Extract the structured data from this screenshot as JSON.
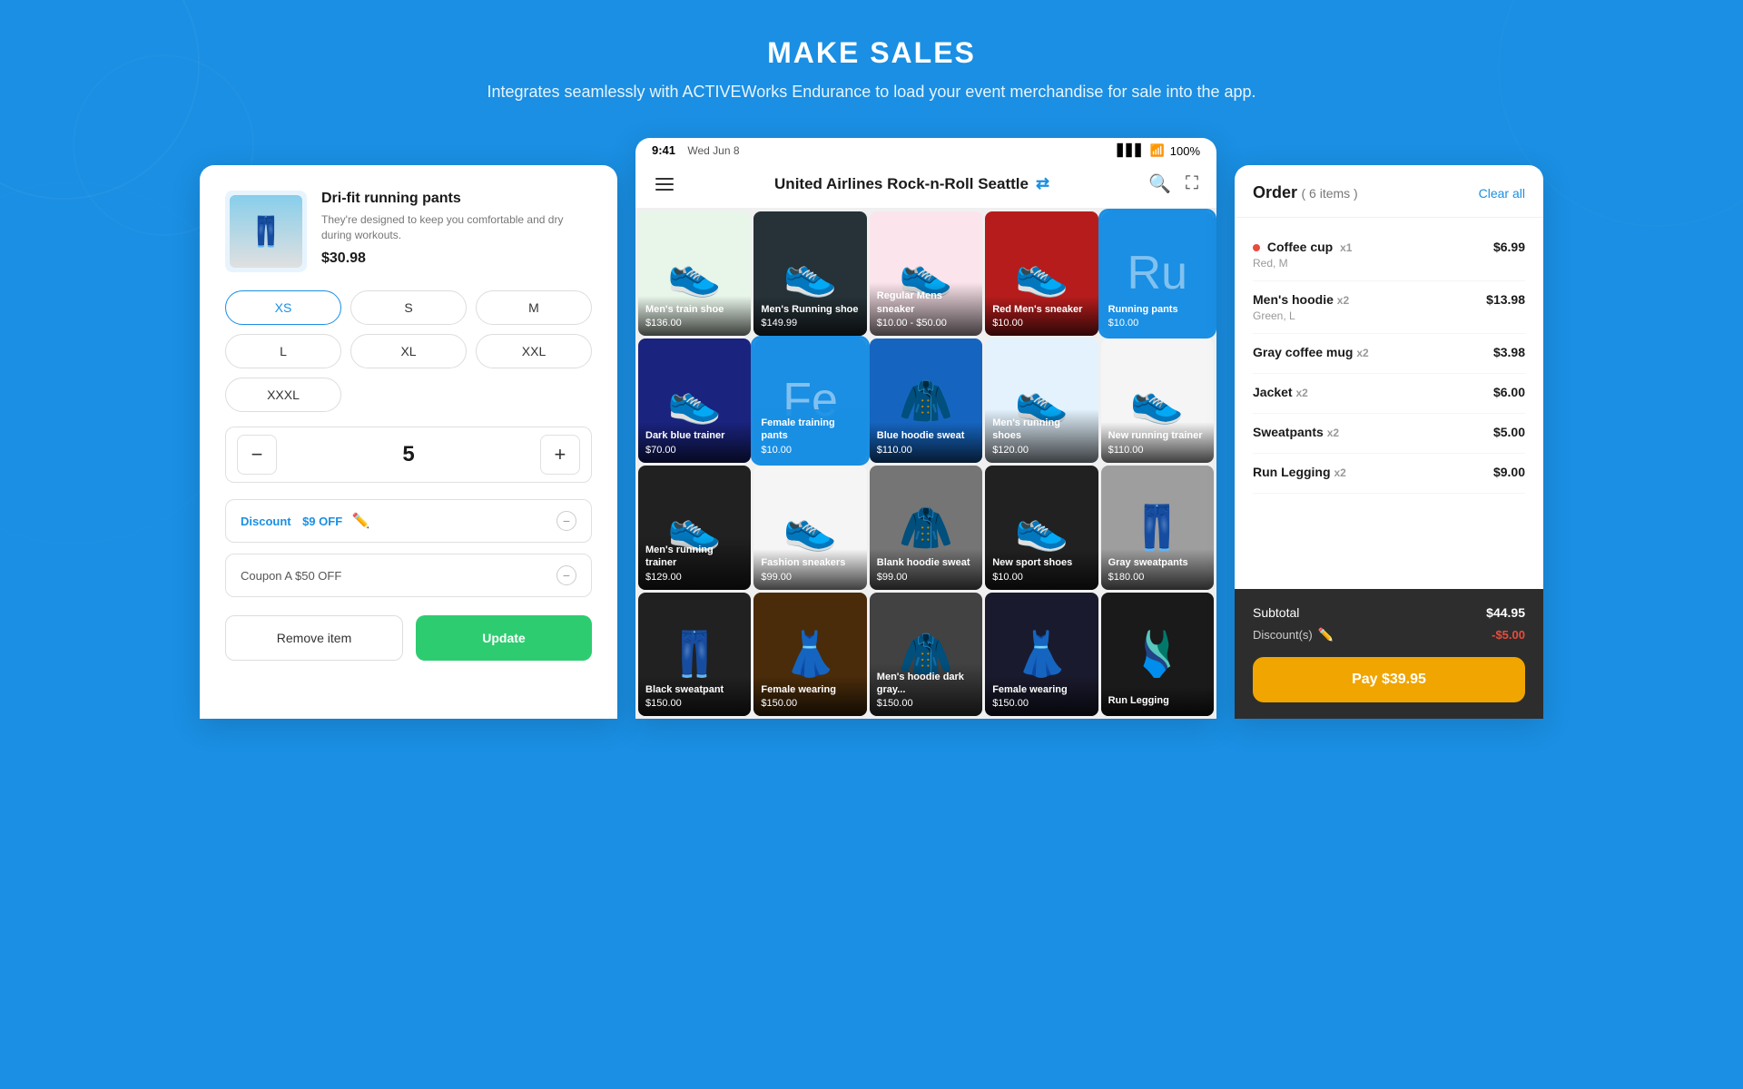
{
  "header": {
    "title": "MAKE SALES",
    "subtitle": "Integrates seamlessly with ACTIVEWorks Endurance to load your event merchandise for sale into the app."
  },
  "status_bar": {
    "time": "9:41",
    "date": "Wed Jun 8",
    "battery": "100%"
  },
  "store": {
    "name": "United Airlines Rock-n-Roll Seattle"
  },
  "product_detail": {
    "name": "Dri-fit running pants",
    "description": "They're designed to keep you comfortable and dry during workouts.",
    "price": "$30.98",
    "sizes": [
      "XS",
      "S",
      "M",
      "L",
      "XL",
      "XXL",
      "XXXL"
    ],
    "selected_size": "XS",
    "quantity": 5,
    "discount_label": "Discount",
    "discount_value": "$9 OFF",
    "coupon_label": "Coupon A $50 OFF",
    "remove_label": "Remove item",
    "update_label": "Update"
  },
  "products": [
    {
      "name": "Men's train shoe",
      "price": "$136.00",
      "bg": "shoe1",
      "selected": false
    },
    {
      "name": "Men's Running shoe",
      "price": "$149.99",
      "bg": "shoe2",
      "selected": false
    },
    {
      "name": "Regular Mens sneaker",
      "price": "$10.00 - $50.00",
      "bg": "shoe3",
      "selected": false
    },
    {
      "name": "Red Men's sneaker",
      "price": "$10.00",
      "bg": "shoe4",
      "selected": false
    },
    {
      "name": "Running pants",
      "price": "$10.00",
      "bg": "blue_solid",
      "selected": true,
      "placeholder": "Ru"
    },
    {
      "name": "Dark blue trainer",
      "price": "$70.00",
      "bg": "shoe5",
      "selected": false
    },
    {
      "name": "Female training pants",
      "price": "$10.00",
      "bg": "blue_selected",
      "selected": true,
      "placeholder": "Fe"
    },
    {
      "name": "Blue hoodie sweat",
      "price": "$110.00",
      "bg": "hoodie",
      "selected": false
    },
    {
      "name": "Men's running shoes",
      "price": "$120.00",
      "bg": "shoe6",
      "selected": false
    },
    {
      "name": "New running trainer",
      "price": "$110.00",
      "bg": "shoe7",
      "selected": false
    },
    {
      "name": "Men's running trainer",
      "price": "$129.00",
      "bg": "shoe8",
      "selected": false
    },
    {
      "name": "Fashion sneakers",
      "price": "$99.00",
      "bg": "shoe9",
      "selected": false
    },
    {
      "name": "Blank hoodie sweat",
      "price": "$99.00",
      "bg": "hoodie2",
      "selected": false
    },
    {
      "name": "New sport shoes",
      "price": "$10.00",
      "bg": "shoe10",
      "selected": false
    },
    {
      "name": "Gray sweatpants",
      "price": "$180.00",
      "bg": "gray_pants",
      "selected": false
    },
    {
      "name": "Black sweatpant",
      "price": "$150.00",
      "bg": "black_pants",
      "selected": false
    },
    {
      "name": "Female wearing",
      "price": "$150.00",
      "bg": "female1",
      "selected": false
    },
    {
      "name": "Men's hoodie dark gray...",
      "price": "$150.00",
      "bg": "hoodie3",
      "selected": false
    },
    {
      "name": "Female wearing",
      "price": "$150.00",
      "bg": "female2",
      "selected": false
    },
    {
      "name": "Run Legging",
      "price": "",
      "bg": "legging",
      "selected": false
    }
  ],
  "order": {
    "title": "Order",
    "item_count": "6 items",
    "clear_label": "Clear all",
    "items": [
      {
        "name": "Coffee cup",
        "qty": "x1",
        "detail": "Red, M",
        "price": "$6.99",
        "has_dot": true
      },
      {
        "name": "Men's hoodie",
        "qty": "x2",
        "detail": "Green, L",
        "price": "$13.98",
        "has_dot": false
      },
      {
        "name": "Gray coffee mug",
        "qty": "x2",
        "detail": "",
        "price": "$3.98",
        "has_dot": false
      },
      {
        "name": "Jacket",
        "qty": "x2",
        "detail": "",
        "price": "$6.00",
        "has_dot": false
      },
      {
        "name": "Sweatpants",
        "qty": "x2",
        "detail": "",
        "price": "$5.00",
        "has_dot": false
      },
      {
        "name": "Run Legging",
        "qty": "x2",
        "detail": "",
        "price": "$9.00",
        "has_dot": false
      }
    ],
    "subtotal_label": "Subtotal",
    "subtotal_value": "$44.95",
    "discount_label": "Discount(s)",
    "discount_value": "-$5.00",
    "pay_label": "Pay $39.95"
  }
}
